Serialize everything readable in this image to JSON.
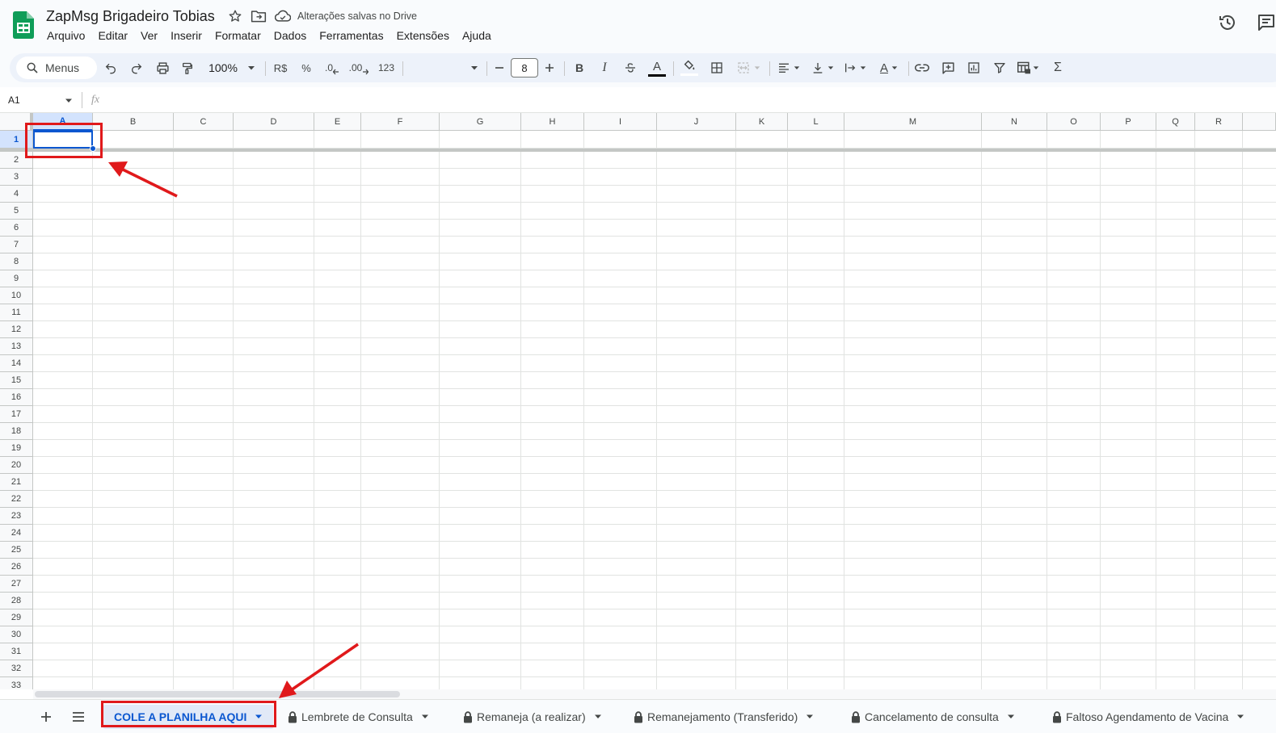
{
  "app": {
    "title": "ZapMsg Brigadeiro Tobias",
    "save_status": "Alterações salvas no Drive",
    "brand_color": "#0f9d58"
  },
  "menu": [
    "Arquivo",
    "Editar",
    "Ver",
    "Inserir",
    "Formatar",
    "Dados",
    "Ferramentas",
    "Extensões",
    "Ajuda"
  ],
  "toolbar": {
    "search_label": "Menus",
    "zoom": "100%",
    "currency": "R$",
    "percent": "%",
    "decrease_decimal": ".0",
    "increase_decimal": ".00",
    "number_format": "123",
    "font_size": "8",
    "bold": "B",
    "italic": "I",
    "text_color_letter": "A",
    "rotate_letter": "A",
    "functions": "Σ"
  },
  "formula_bar": {
    "cell_ref": "A1",
    "fx": "fx"
  },
  "columns": [
    "A",
    "B",
    "C",
    "D",
    "E",
    "F",
    "G",
    "H",
    "I",
    "J",
    "K",
    "L",
    "M",
    "N",
    "O",
    "P",
    "Q",
    "R"
  ],
  "rows": [
    "1",
    "2",
    "3",
    "4",
    "5",
    "6",
    "7",
    "8",
    "9",
    "10",
    "11",
    "12",
    "13",
    "14",
    "15",
    "16",
    "17",
    "18",
    "19",
    "20",
    "21",
    "22",
    "23",
    "24",
    "25",
    "26",
    "27",
    "28",
    "29",
    "30",
    "31",
    "32",
    "33"
  ],
  "selected": {
    "column": "A",
    "row": "1"
  },
  "sheets": [
    {
      "name": "COLE A PLANILHA AQUI",
      "active": true,
      "locked": false
    },
    {
      "name": "Lembrete de Consulta",
      "active": false,
      "locked": true
    },
    {
      "name": "Remaneja (a realizar)",
      "active": false,
      "locked": true
    },
    {
      "name": "Remanejamento (Transferido)",
      "active": false,
      "locked": true
    },
    {
      "name": "Cancelamento de consulta",
      "active": false,
      "locked": true
    },
    {
      "name": "Faltoso Agendamento de Vacina",
      "active": false,
      "locked": true
    }
  ],
  "colors": {
    "accent": "#0b57d0",
    "annotation": "#e0191b",
    "grid_line": "#e1e3e1"
  }
}
